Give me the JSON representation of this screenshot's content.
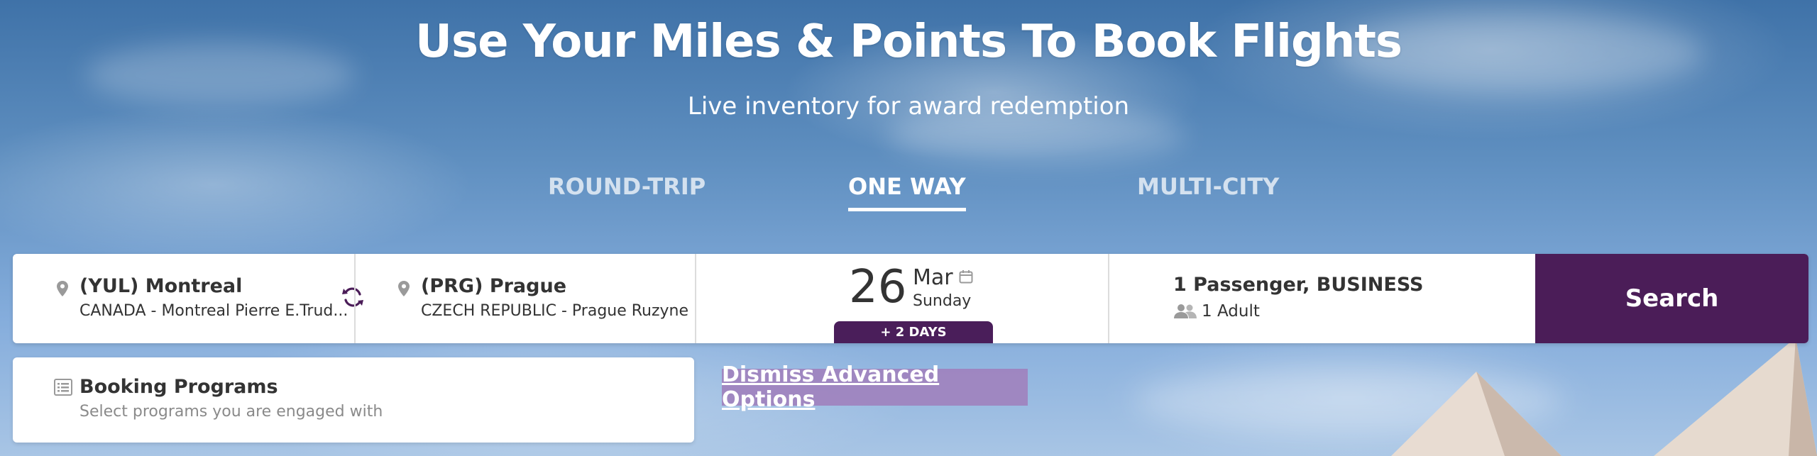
{
  "hero": {
    "title": "Use Your Miles & Points To Book Flights",
    "subtitle": "Live inventory for award redemption"
  },
  "tabs": [
    {
      "label": "ROUND-TRIP",
      "active": false
    },
    {
      "label": "ONE WAY",
      "active": true
    },
    {
      "label": "MULTI-CITY",
      "active": false
    }
  ],
  "search": {
    "origin": {
      "code_city": "(YUL) Montreal",
      "detail": "CANADA - Montreal Pierre E.Trud...",
      "icon": "map-pin-icon"
    },
    "swap_icon": "swap-icon",
    "destination": {
      "code_city": "(PRG) Prague",
      "detail": "CZECH REPUBLIC - Prague Ruzyne",
      "icon": "map-pin-icon"
    },
    "date": {
      "day": "26",
      "month": "Mar",
      "weekday": "Sunday",
      "badge": "+ 2 DAYS",
      "icon": "calendar-icon"
    },
    "passengers": {
      "summary": "1 Passenger, BUSINESS",
      "detail": "1 Adult",
      "icon": "people-icon"
    },
    "button_label": "Search"
  },
  "programs": {
    "title": "Booking Programs",
    "subtitle": "Select programs you are engaged with",
    "icon": "list-icon"
  },
  "dismiss_label": "Dismiss Advanced Options",
  "colors": {
    "brand_purple": "#4b1d58",
    "dismiss_bg": "#a082be",
    "text": "#333333",
    "muted": "#8a8a8a"
  }
}
